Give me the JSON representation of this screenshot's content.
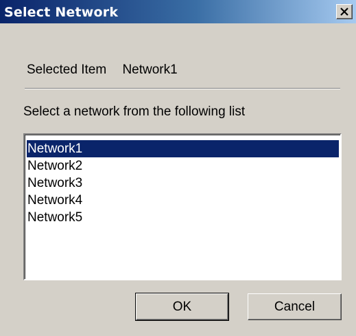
{
  "window": {
    "title": "Select Network",
    "close_icon": "close-icon"
  },
  "selected": {
    "label": "Selected Item",
    "value": "Network1"
  },
  "instruction": "Select a network from the following list",
  "networks": {
    "items": [
      "Network1",
      "Network2",
      "Network3",
      "Network4",
      "Network5"
    ],
    "selected_index": 0
  },
  "buttons": {
    "ok": "OK",
    "cancel": "Cancel"
  },
  "colors": {
    "titlebar_start": "#0a246a",
    "titlebar_end": "#a6caf0",
    "selection": "#0a246a",
    "dialog_bg": "#d4d0c8"
  }
}
